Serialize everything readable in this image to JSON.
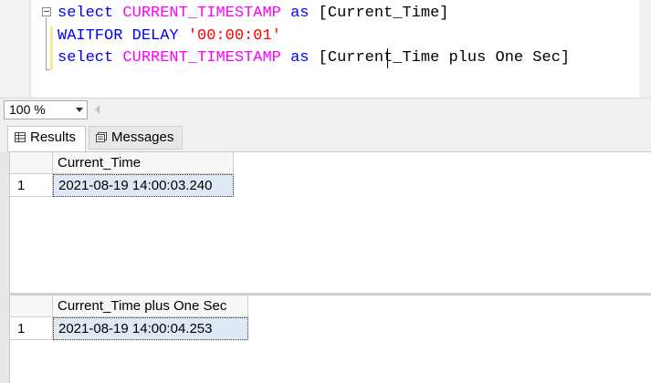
{
  "editor": {
    "lines": [
      [
        {
          "t": "select",
          "c": "kw"
        },
        {
          "t": " ",
          "c": "tx"
        },
        {
          "t": "CURRENT_TIMESTAMP",
          "c": "fn"
        },
        {
          "t": " ",
          "c": "tx"
        },
        {
          "t": "as",
          "c": "kw"
        },
        {
          "t": " [Current_Time]",
          "c": "tx"
        }
      ],
      [
        {
          "t": "WAITFOR DELAY",
          "c": "kw"
        },
        {
          "t": " ",
          "c": "tx"
        },
        {
          "t": "'00:00:01'",
          "c": "str"
        }
      ],
      [
        {
          "t": "select",
          "c": "kw"
        },
        {
          "t": " ",
          "c": "tx"
        },
        {
          "t": "CURRENT_TIMESTAMP",
          "c": "fn"
        },
        {
          "t": " ",
          "c": "tx"
        },
        {
          "t": "as",
          "c": "kw"
        },
        {
          "t": " [Current_Time plus One Sec]",
          "c": "tx"
        }
      ]
    ]
  },
  "zoom": {
    "value": "100 %"
  },
  "tabs": {
    "results_label": "Results",
    "messages_label": "Messages"
  },
  "results": [
    {
      "column": "Current_Time",
      "row_number": "1",
      "value": "2021-08-19 14:00:03.240"
    },
    {
      "column": "Current_Time plus One Sec",
      "row_number": "1",
      "value": "2021-08-19 14:00:04.253"
    }
  ],
  "colors": {
    "keyword": "#0000ff",
    "function": "#ff00ff",
    "string": "#ff0000",
    "selected_cell": "#dfe9f5"
  },
  "icons": {
    "results_tab": "grid-icon",
    "messages_tab": "messages-icon"
  }
}
